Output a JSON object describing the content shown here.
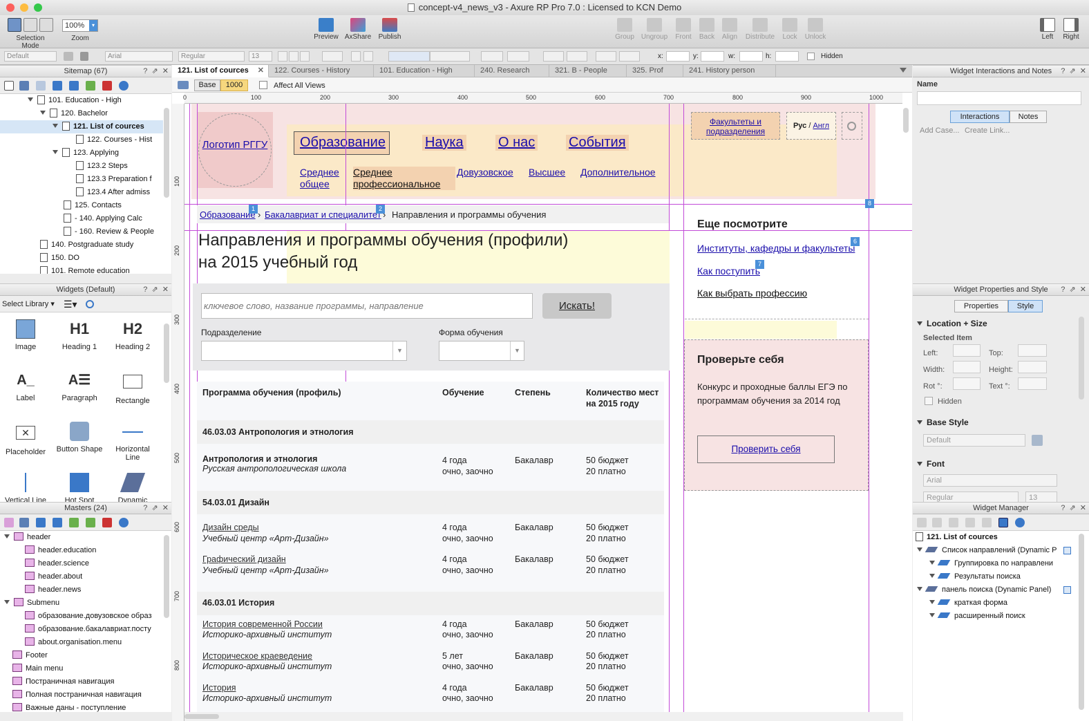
{
  "window": {
    "title": "concept-v4_news_v3 - Axure RP Pro 7.0 : Licensed to KCN Demo"
  },
  "toolbar": {
    "selection_mode": "Selection Mode",
    "zoom_label": "Zoom",
    "zoom_value": "100%",
    "preview": "Preview",
    "axshare": "AxShare",
    "publish": "Publish",
    "group": "Group",
    "ungroup": "Ungroup",
    "front": "Front",
    "back": "Back",
    "align": "Align",
    "distribute": "Distribute",
    "lock": "Lock",
    "unlock": "Unlock",
    "left": "Left",
    "right": "Right"
  },
  "format_bar": {
    "style": "Default",
    "font": "Arial",
    "weight": "Regular",
    "size": "13",
    "x_label": "x:",
    "y_label": "y:",
    "w_label": "w:",
    "h_label": "h:",
    "hidden_label": "Hidden"
  },
  "sitemap": {
    "title": "Sitemap (67)",
    "items": [
      {
        "label": "101. Education - High"
      },
      {
        "label": "120. Bachelor"
      },
      {
        "label": "121. List of cources"
      },
      {
        "label": "122. Courses - Hist"
      },
      {
        "label": "123. Applying"
      },
      {
        "label": "123.2 Steps"
      },
      {
        "label": "123.3 Preparation f"
      },
      {
        "label": "123.4 After admiss"
      },
      {
        "label": "125. Contacts"
      },
      {
        "label": "- 140. Applying Calc"
      },
      {
        "label": "- 160. Review & People"
      },
      {
        "label": "140. Postgraduate study"
      },
      {
        "label": "150. DO"
      },
      {
        "label": "101. Remote education"
      }
    ]
  },
  "widgets": {
    "title": "Widgets (Default)",
    "select_library": "Select Library",
    "items": [
      {
        "label": "Image",
        "icon": "image-icon"
      },
      {
        "label": "Heading 1",
        "icon": "H1"
      },
      {
        "label": "Heading 2",
        "icon": "H2"
      },
      {
        "label": "Label",
        "icon": "label-icon"
      },
      {
        "label": "Paragraph",
        "icon": "paragraph-icon"
      },
      {
        "label": "Rectangle",
        "icon": "rectangle-icon"
      },
      {
        "label": "Placeholder",
        "icon": "placeholder-icon"
      },
      {
        "label": "Button Shape",
        "icon": "button-shape-icon"
      },
      {
        "label": "Horizontal Line",
        "icon": "hline-icon"
      },
      {
        "label": "Vertical Line",
        "icon": "vline-icon"
      },
      {
        "label": "Hot Spot",
        "icon": "hotspot-icon"
      },
      {
        "label": "Dynamic",
        "icon": "dynamic-panel-icon"
      }
    ]
  },
  "masters": {
    "title": "Masters (24)",
    "items": [
      {
        "label": "header"
      },
      {
        "label": "header.education"
      },
      {
        "label": "header.science"
      },
      {
        "label": "header.about"
      },
      {
        "label": "header.news"
      },
      {
        "label": "Submenu"
      },
      {
        "label": "образование.довузовское образ"
      },
      {
        "label": "образование.бакалавриат.посту"
      },
      {
        "label": "about.organisation.menu"
      },
      {
        "label": "Footer"
      },
      {
        "label": "Main menu"
      },
      {
        "label": "Постраничная навигация"
      },
      {
        "label": "Полная постраничная навигация"
      },
      {
        "label": "Важные даны - поступление"
      }
    ]
  },
  "tabs": [
    {
      "label": "121. List of cources"
    },
    {
      "label": "122. Courses - History"
    },
    {
      "label": "101. Education - High"
    },
    {
      "label": "240. Research"
    },
    {
      "label": "321. B - People"
    },
    {
      "label": "325. Prof"
    },
    {
      "label": "241. History person"
    }
  ],
  "views": {
    "base": "Base",
    "width": "1000",
    "affect_all": "Affect All Views"
  },
  "ruler": {
    "h": [
      "0",
      "100",
      "200",
      "300",
      "400",
      "500",
      "600",
      "700",
      "800",
      "900",
      "1000"
    ],
    "v": [
      "100",
      "200",
      "300",
      "400",
      "500",
      "600",
      "700",
      "800"
    ]
  },
  "page": {
    "logo": "Логотип РГГУ",
    "top_links": {
      "faculties": "Факультеты и подразделения",
      "lang_ru": "Рус",
      "lang_sep": " / ",
      "lang_en": "Англ"
    },
    "nav1": [
      "Образование",
      "Наука",
      "О нас",
      "События"
    ],
    "nav2": [
      "Среднее общее",
      "Среднее профессиональное",
      "Довузовское",
      "Высшее",
      "Дополнительное"
    ],
    "breadcrumb": [
      "Образование",
      "Бакалавриат и специалитет",
      "Направления и программы обучения"
    ],
    "breadcrumb_sep": "›",
    "badges": [
      "1",
      "2",
      "6",
      "7",
      "8"
    ],
    "heading_line1": "Направления и программы обучения (профили)",
    "heading_line2": "на 2015 учебный год",
    "search_placeholder": "ключевое слово, название программы, направление",
    "search_button": "Искать!",
    "filter1_label": "Подразделение",
    "filter2_label": "Форма обучения",
    "table_headers": [
      "Программа обучения (профиль)",
      "Обучение",
      "Степень",
      "Количество мест на 2015 году"
    ],
    "groups": [
      {
        "title": "46.03.03 Антропология и этнология",
        "rows": [
          {
            "name": "Антропология и этнология",
            "org": "Русская антропологическая школа",
            "dur": "4 года",
            "form": "очно, заочно",
            "deg": "Бакалавр",
            "b": "50 бюджет",
            "p": "20 платно",
            "link": false
          }
        ]
      },
      {
        "title": "54.03.01 Дизайн",
        "rows": [
          {
            "name": "Дизайн среды",
            "org": "Учебный центр «Арт-Дизайн»",
            "dur": "4 года",
            "form": "очно, заочно",
            "deg": "Бакалавр",
            "b": "50 бюджет",
            "p": "20 платно",
            "link": true
          },
          {
            "name": "Графический дизайн",
            "org": "Учебный центр «Арт-Дизайн»",
            "dur": "4 года",
            "form": "очно, заочно",
            "deg": "Бакалавр",
            "b": "50 бюджет",
            "p": "20 платно",
            "link": true
          }
        ]
      },
      {
        "title": "46.03.01 История",
        "rows": [
          {
            "name": "История современной России",
            "org": "Историко-архивный институт",
            "dur": "4 года",
            "form": "очно, заочно",
            "deg": "Бакалавр",
            "b": "50 бюджет",
            "p": "20 платно",
            "link": true
          },
          {
            "name": "Историческое краеведение",
            "org": "Историко-архивный институт",
            "dur": "5 лет",
            "form": "очно, заочно",
            "deg": "Бакалавр",
            "b": "50 бюджет",
            "p": "20 платно",
            "link": true
          },
          {
            "name": "История",
            "org": "Историко-архивный институт",
            "dur": "4 года",
            "form": "очно, заочно",
            "deg": "Бакалавр",
            "b": "50 бюджет",
            "p": "20 платно",
            "link": true
          }
        ]
      }
    ],
    "see_also_title": "Еще посмотрите",
    "see_also": [
      "Институты, кафедры и факультеты",
      "Как поступить",
      "Как выбрать профессию"
    ],
    "check_title": "Проверьте себя",
    "check_text": "Конкурс и проходные баллы ЕГЭ по программам обучения за 2014 год",
    "check_button": "Проверить себя"
  },
  "interactions_panel": {
    "title": "Widget Interactions and Notes",
    "name_label": "Name",
    "tab_interactions": "Interactions",
    "tab_notes": "Notes",
    "add_case": "Add Case...",
    "create_link": "Create Link..."
  },
  "properties_panel": {
    "title": "Widget Properties and Style",
    "tab_properties": "Properties",
    "tab_style": "Style",
    "location_size": "Location + Size",
    "selected_item": "Selected Item",
    "left": "Left:",
    "top": "Top:",
    "width": "Width:",
    "height": "Height:",
    "rot": "Rot °:",
    "text_rot": "Text °:",
    "hidden": "Hidden",
    "base_style": "Base Style",
    "base_style_value": "Default",
    "font": "Font",
    "font_value": "Arial",
    "font_weight": "Regular",
    "font_size": "13"
  },
  "widget_manager": {
    "title": "Widget Manager",
    "page": "121. List of cources",
    "items": [
      {
        "label": "Список направлений (Dynamic P",
        "level": 0
      },
      {
        "label": "Группировка по направлени",
        "level": 1
      },
      {
        "label": "Результаты поиска",
        "level": 1
      },
      {
        "label": "панель поиска (Dynamic Panel)",
        "level": 0
      },
      {
        "label": "краткая форма",
        "level": 1
      },
      {
        "label": "расширенный поиск",
        "level": 1
      }
    ]
  },
  "colors": {
    "accent": "#4a90d9",
    "guide": "#c24bd8",
    "link": "#1a0dab"
  }
}
